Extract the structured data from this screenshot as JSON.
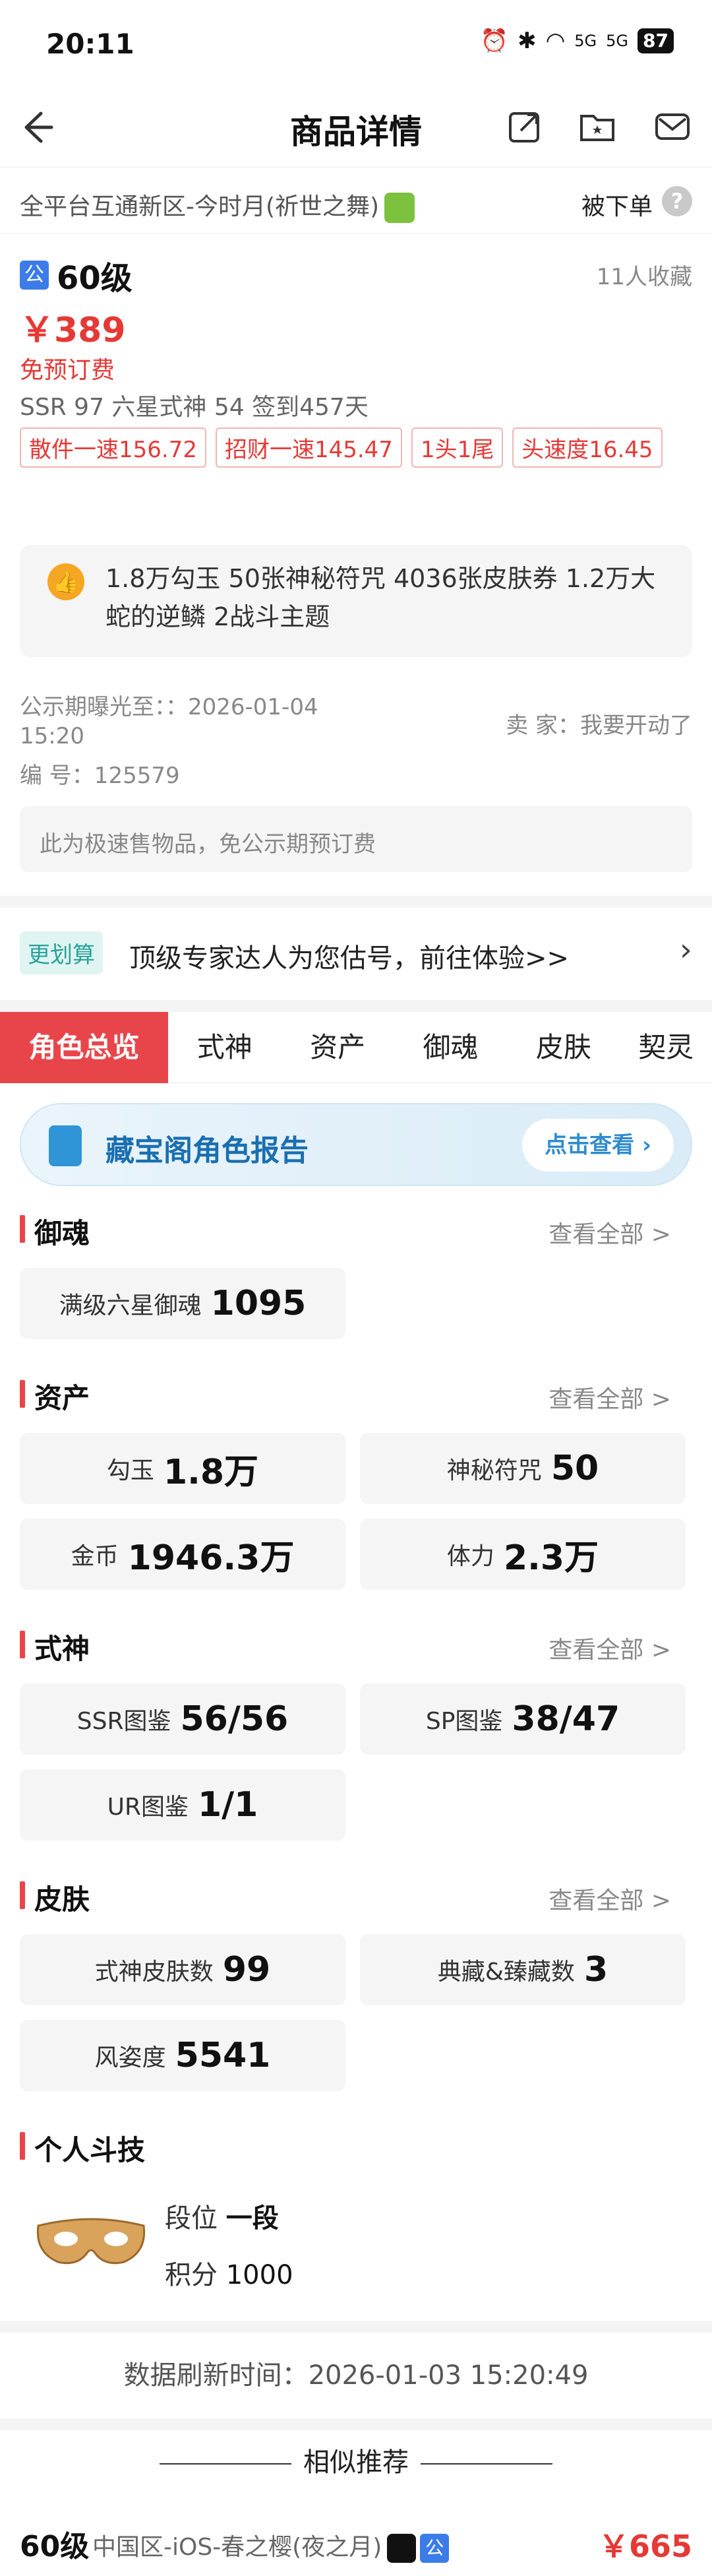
{
  "status": {
    "time": "20:11",
    "signal1": "5G",
    "signal2": "5G",
    "battery": "87"
  },
  "nav": {
    "title": "商品详情"
  },
  "server": {
    "name": "全平台互通新区-今时月(祈世之舞)",
    "bargain_label": "被下单",
    "help": "?"
  },
  "product": {
    "badge": "公",
    "level": "60级",
    "favorites": "11人收藏",
    "price": "￥389",
    "free_booking": "免预订费",
    "stats": "SSR 97   六星式神 54   签到457天",
    "tags": [
      "散件一速156.72",
      "招财一速145.47",
      "1头1尾",
      "头速度16.45"
    ],
    "summary": "1.8万勾玉 50张神秘符咒 4036张皮肤券 1.2万大蛇的逆鳞 2战斗主题",
    "publish_label": "公示期曝光至：：2026-01-04",
    "publish_time": "15:20",
    "seller": "卖 家：我要开动了",
    "serial": "编 号：125579",
    "notice": "此为极速售物品，免公示期预订费"
  },
  "promo": {
    "badge": "更划算",
    "text": "顶级专家达人为您估号，前往体验>>",
    "arrow": "›"
  },
  "tabs": [
    "角色总览",
    "式神",
    "资产",
    "御魂",
    "皮肤",
    "契灵"
  ],
  "report": {
    "title": "藏宝阁角色报告",
    "button": "点击查看 ›"
  },
  "sections": {
    "yuhun": {
      "title": "御魂",
      "more": "查看全部 >",
      "cards": [
        {
          "label": "满级六星御魂",
          "value": "1095"
        }
      ]
    },
    "assets": {
      "title": "资产",
      "more": "查看全部 >",
      "cards": [
        {
          "label": "勾玉",
          "value": "1.8万"
        },
        {
          "label": "神秘符咒",
          "value": "50"
        },
        {
          "label": "金币",
          "value": "1946.3万"
        },
        {
          "label": "体力",
          "value": "2.3万"
        }
      ]
    },
    "shishen": {
      "title": "式神",
      "more": "查看全部 >",
      "cards": [
        {
          "label": "SSR图鉴",
          "value": "56/56"
        },
        {
          "label": "SP图鉴",
          "value": "38/47"
        },
        {
          "label": "UR图鉴",
          "value": "1/1"
        }
      ]
    },
    "skins": {
      "title": "皮肤",
      "more": "查看全部 >",
      "cards": [
        {
          "label": "式神皮肤数",
          "value": "99"
        },
        {
          "label": "典藏&臻藏数",
          "value": "3"
        },
        {
          "label": "风姿度",
          "value": "5541"
        }
      ]
    },
    "douji": {
      "title": "个人斗技",
      "rank_label": "段位",
      "rank_value": "一段",
      "score_label": "积分",
      "score_value": "1000"
    }
  },
  "refresh": "数据刷新时间：2026-01-03 15:20:49",
  "similar": {
    "title": "相似推荐"
  },
  "item": {
    "level": "60级",
    "server": "中国区-iOS-春之樱(夜之月)",
    "badge": "公",
    "price": "￥665"
  },
  "colors": {
    "accent": "#e8454a",
    "price": "#e53935",
    "report": "#1a6fb0"
  }
}
